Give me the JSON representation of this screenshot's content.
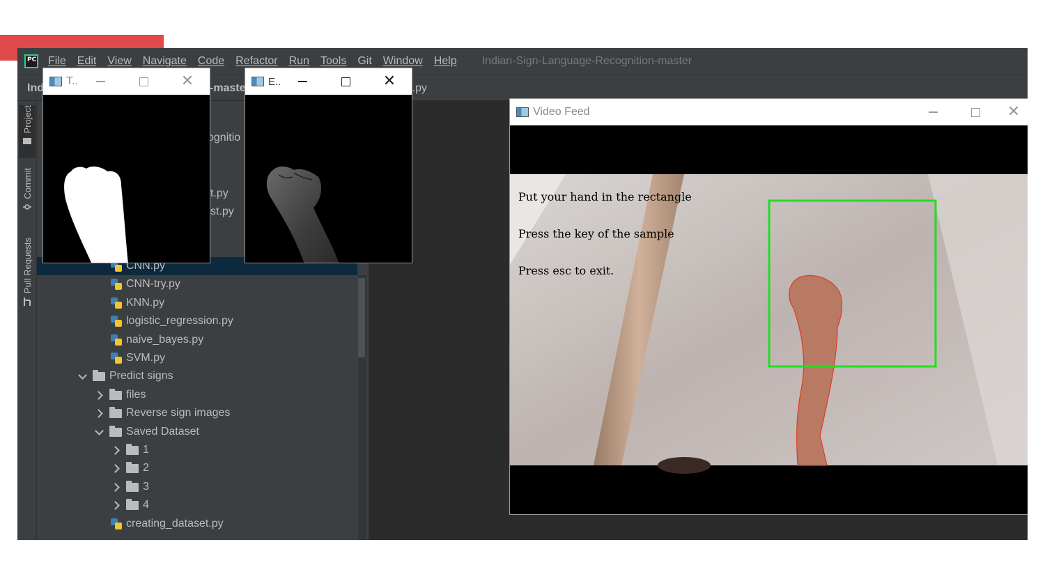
{
  "menu": {
    "items": [
      "File",
      "Edit",
      "View",
      "Navigate",
      "Code",
      "Refactor",
      "Run",
      "Tools",
      "Git",
      "Window",
      "Help"
    ],
    "project_title": "Indian-Sign-Language-Recognition-master"
  },
  "navbar": {
    "left_fragment": "Ind",
    "mid_fragment": "-maste",
    "tab_fragment": "N.py"
  },
  "toolstrip": {
    "tabs": [
      "Project",
      "Commit",
      "Pull Requests"
    ]
  },
  "tree": {
    "partial_labels": [
      "ognitio",
      "t.py",
      "st.py"
    ],
    "rows": [
      {
        "label": "CNN.py",
        "type": "py",
        "indent": 3,
        "selected": true
      },
      {
        "label": "CNN-try.py",
        "type": "py",
        "indent": 3
      },
      {
        "label": "KNN.py",
        "type": "py",
        "indent": 3
      },
      {
        "label": "logistic_regression.py",
        "type": "py",
        "indent": 3
      },
      {
        "label": "naive_bayes.py",
        "type": "py",
        "indent": 3
      },
      {
        "label": "SVM.py",
        "type": "py",
        "indent": 3
      },
      {
        "label": "Predict signs",
        "type": "folder",
        "indent": 1,
        "expanded": true
      },
      {
        "label": "files",
        "type": "folder",
        "indent": 2,
        "expanded": false
      },
      {
        "label": "Reverse sign images",
        "type": "folder",
        "indent": 2,
        "expanded": false
      },
      {
        "label": "Saved Dataset",
        "type": "folder",
        "indent": 2,
        "expanded": true
      },
      {
        "label": "1",
        "type": "folder",
        "indent": 3,
        "expanded": false
      },
      {
        "label": "2",
        "type": "folder",
        "indent": 3,
        "expanded": false
      },
      {
        "label": "3",
        "type": "folder",
        "indent": 3,
        "expanded": false
      },
      {
        "label": "4",
        "type": "folder",
        "indent": 3,
        "expanded": false
      },
      {
        "label": "creating_dataset.py",
        "type": "py",
        "indent": 3
      }
    ]
  },
  "windows": {
    "threshold": {
      "title": "T.."
    },
    "edge": {
      "title": "E.."
    },
    "video": {
      "title": "Video Feed",
      "overlay_lines": [
        "Put your hand in the rectangle",
        "Press the key of the sample",
        "Press esc to exit."
      ],
      "rect_color": "#22dd22"
    }
  },
  "colors": {
    "accent": "#e04a4a",
    "ide_bg": "#2b2b2b",
    "panel_bg": "#3c3f41",
    "selection": "#0d293e"
  }
}
